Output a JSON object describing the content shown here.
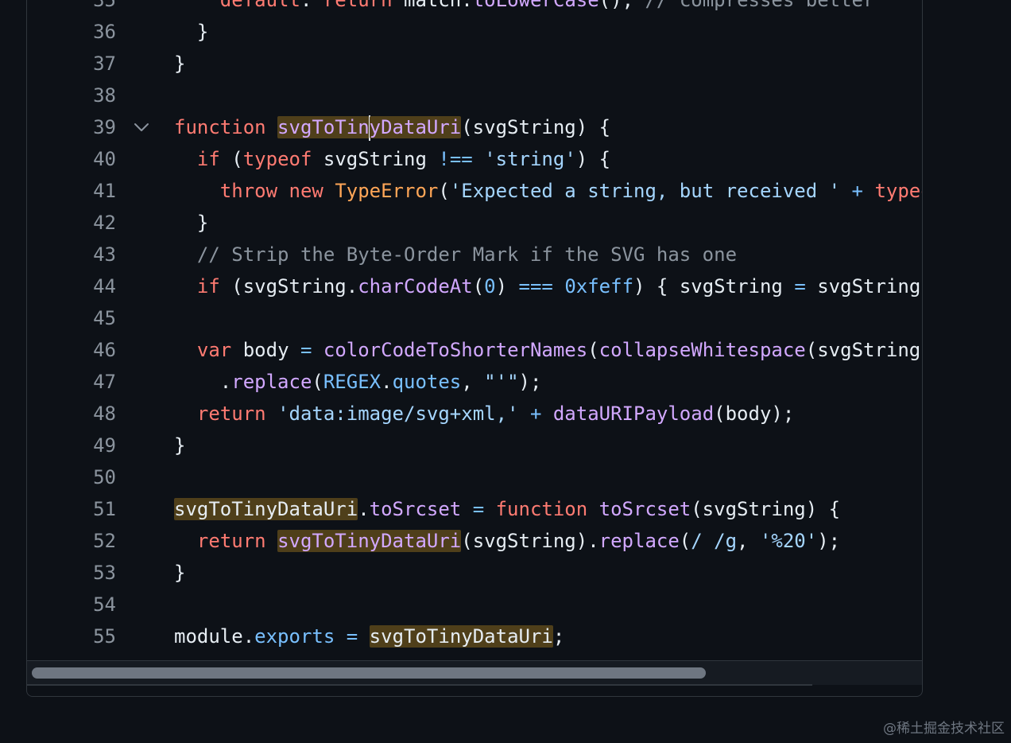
{
  "code_lines": [
    {
      "number": "35",
      "tokens": [
        {
          "t": "    "
        },
        {
          "t": "default",
          "c": "keyword"
        },
        {
          "t": ": "
        },
        {
          "t": "return",
          "c": "keyword"
        },
        {
          "t": " match."
        },
        {
          "t": "toLowerCase",
          "c": "function"
        },
        {
          "t": "(); "
        },
        {
          "t": "// compresses better",
          "c": "comment"
        }
      ]
    },
    {
      "number": "36",
      "tokens": [
        {
          "t": "  }"
        }
      ]
    },
    {
      "number": "37",
      "tokens": [
        {
          "t": "}"
        }
      ]
    },
    {
      "number": "38",
      "tokens": []
    },
    {
      "number": "39",
      "fold": true,
      "tokens": [
        {
          "t": "function",
          "c": "keyword"
        },
        {
          "t": " "
        },
        {
          "t": "svgToTin",
          "c": "function",
          "hl": true
        },
        {
          "cursor": true
        },
        {
          "t": "yDataUri",
          "c": "function",
          "hl": true
        },
        {
          "t": "(svgString) {"
        }
      ]
    },
    {
      "number": "40",
      "tokens": [
        {
          "t": "  "
        },
        {
          "t": "if",
          "c": "keyword"
        },
        {
          "t": " ("
        },
        {
          "t": "typeof",
          "c": "keyword"
        },
        {
          "t": " svgString "
        },
        {
          "t": "!==",
          "c": "operator"
        },
        {
          "t": " "
        },
        {
          "t": "'string'",
          "c": "string"
        },
        {
          "t": ") {"
        }
      ]
    },
    {
      "number": "41",
      "tokens": [
        {
          "t": "    "
        },
        {
          "t": "throw",
          "c": "keyword"
        },
        {
          "t": " "
        },
        {
          "t": "new",
          "c": "keyword"
        },
        {
          "t": " "
        },
        {
          "t": "TypeError",
          "c": "class"
        },
        {
          "t": "("
        },
        {
          "t": "'Expected a string, but received '",
          "c": "string"
        },
        {
          "t": " "
        },
        {
          "t": "+",
          "c": "operator"
        },
        {
          "t": " "
        },
        {
          "t": "typeof",
          "c": "keyword"
        }
      ]
    },
    {
      "number": "42",
      "tokens": [
        {
          "t": "  }"
        }
      ]
    },
    {
      "number": "43",
      "tokens": [
        {
          "t": "  "
        },
        {
          "t": "// Strip the Byte-Order Mark if the SVG has one",
          "c": "comment"
        }
      ]
    },
    {
      "number": "44",
      "tokens": [
        {
          "t": "  "
        },
        {
          "t": "if",
          "c": "keyword"
        },
        {
          "t": " (svgString."
        },
        {
          "t": "charCodeAt",
          "c": "function"
        },
        {
          "t": "("
        },
        {
          "t": "0",
          "c": "number"
        },
        {
          "t": ") "
        },
        {
          "t": "===",
          "c": "operator"
        },
        {
          "t": " "
        },
        {
          "t": "0xfeff",
          "c": "number"
        },
        {
          "t": ") { svgString "
        },
        {
          "t": "=",
          "c": "operator"
        },
        {
          "t": " svgString."
        }
      ]
    },
    {
      "number": "45",
      "tokens": []
    },
    {
      "number": "46",
      "tokens": [
        {
          "t": "  "
        },
        {
          "t": "var",
          "c": "keyword"
        },
        {
          "t": " body "
        },
        {
          "t": "=",
          "c": "operator"
        },
        {
          "t": " "
        },
        {
          "t": "colorCodeToShorterNames",
          "c": "function"
        },
        {
          "t": "("
        },
        {
          "t": "collapseWhitespace",
          "c": "function"
        },
        {
          "t": "(svgString))"
        }
      ]
    },
    {
      "number": "47",
      "tokens": [
        {
          "t": "    ."
        },
        {
          "t": "replace",
          "c": "function"
        },
        {
          "t": "("
        },
        {
          "t": "REGEX",
          "c": "constant"
        },
        {
          "t": "."
        },
        {
          "t": "quotes",
          "c": "property"
        },
        {
          "t": ", "
        },
        {
          "t": "\"'\"",
          "c": "string"
        },
        {
          "t": ");"
        }
      ]
    },
    {
      "number": "48",
      "tokens": [
        {
          "t": "  "
        },
        {
          "t": "return",
          "c": "keyword"
        },
        {
          "t": " "
        },
        {
          "t": "'data:image/svg+xml,'",
          "c": "string"
        },
        {
          "t": " "
        },
        {
          "t": "+",
          "c": "operator"
        },
        {
          "t": " "
        },
        {
          "t": "dataURIPayload",
          "c": "function"
        },
        {
          "t": "(body);"
        }
      ]
    },
    {
      "number": "49",
      "tokens": [
        {
          "t": "}"
        }
      ]
    },
    {
      "number": "50",
      "tokens": []
    },
    {
      "number": "51",
      "tokens": [
        {
          "t": "svgToTinyDataUri",
          "hl": true
        },
        {
          "t": "."
        },
        {
          "t": "toSrcset",
          "c": "function"
        },
        {
          "t": " "
        },
        {
          "t": "=",
          "c": "operator"
        },
        {
          "t": " "
        },
        {
          "t": "function",
          "c": "keyword"
        },
        {
          "t": " "
        },
        {
          "t": "toSrcset",
          "c": "function"
        },
        {
          "t": "(svgString) {"
        }
      ]
    },
    {
      "number": "52",
      "tokens": [
        {
          "t": "  "
        },
        {
          "t": "return",
          "c": "keyword"
        },
        {
          "t": " "
        },
        {
          "t": "svgToTinyDataUri",
          "c": "function",
          "hl": true
        },
        {
          "t": "(svgString)."
        },
        {
          "t": "replace",
          "c": "function"
        },
        {
          "t": "("
        },
        {
          "t": "/ /g",
          "c": "string"
        },
        {
          "t": ", "
        },
        {
          "t": "'%20'",
          "c": "string"
        },
        {
          "t": ");"
        }
      ]
    },
    {
      "number": "53",
      "tokens": [
        {
          "t": "}"
        }
      ]
    },
    {
      "number": "54",
      "tokens": []
    },
    {
      "number": "55",
      "tokens": [
        {
          "t": "module."
        },
        {
          "t": "exports",
          "c": "property"
        },
        {
          "t": " "
        },
        {
          "t": "=",
          "c": "operator"
        },
        {
          "t": " "
        },
        {
          "t": "svgToTinyDataUri",
          "hl": true
        },
        {
          "t": ";"
        }
      ]
    }
  ],
  "watermark": "@稀土掘金技术社区",
  "icons": {
    "fold": "chevron-down-icon"
  },
  "colors": {
    "background": "#0d1117",
    "keyword": "#ff7b72",
    "function": "#d2a8ff",
    "string": "#a5d6ff",
    "constant": "#79c0ff",
    "comment": "#8b949e",
    "class": "#ffa657",
    "highlight": "#4f3f1a"
  }
}
